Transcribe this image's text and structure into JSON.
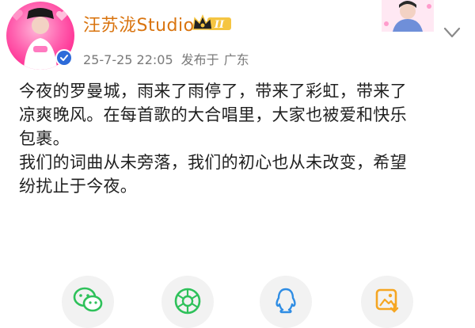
{
  "post": {
    "author": {
      "name": "汪苏泷Studio",
      "verified": true,
      "badge_icon": "crown-vip-badge-icon",
      "name_color": "#d9740f"
    },
    "meta": {
      "date": "25-7-25 22:05",
      "location_prefix": "发布于",
      "location": "广东"
    },
    "content_lines": [
      "今夜的罗曼城，雨来了雨停了，带来了彩虹，带来了",
      "凉爽晚风。在每首歌的大合唱里，大家也被爱和快乐",
      "包裹。",
      "我们的词曲从未旁落，我们的初心也从未改变，希望",
      "纷扰止于今夜。"
    ],
    "more_icon": "chevron-down-icon"
  },
  "share_bar": {
    "items": [
      {
        "icon": "wechat-icon",
        "color": "#2ec15a"
      },
      {
        "icon": "moments-icon",
        "color": "#2ec15a"
      },
      {
        "icon": "qq-icon",
        "color": "#2f8de4"
      },
      {
        "icon": "save-image-icon",
        "color": "#f5a623"
      }
    ]
  }
}
